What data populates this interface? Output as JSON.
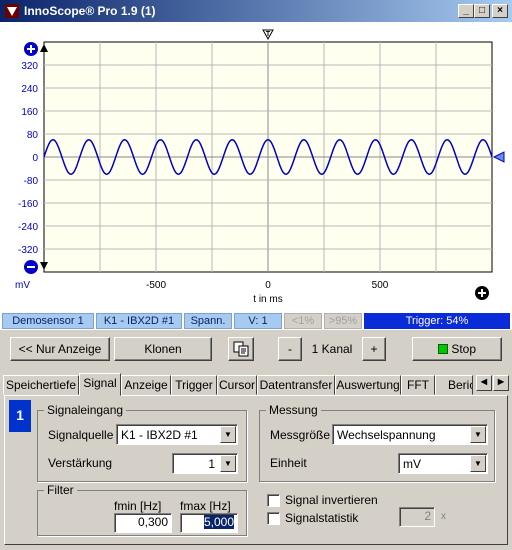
{
  "window": {
    "title": "InnoScope® Pro 1.9 (1)",
    "controls": [
      "_",
      "□",
      "×"
    ]
  },
  "plot": {
    "y_unit": "mV",
    "x_label": "t in ms",
    "trigger_marker": "T",
    "colors": {
      "trace": "#0000c8",
      "grid": "#b8b8b8",
      "background": "#fffff0"
    },
    "icons": [
      "zoom-in-icon",
      "zoom-out-icon",
      "zoom-x-icon",
      "trigger-arrow-icon"
    ]
  },
  "chart_data": {
    "type": "line",
    "xlabel": "t in ms",
    "ylabel": "mV",
    "xlim": [
      -1000,
      1000
    ],
    "ylim": [
      -400,
      400
    ],
    "x_ticks": [
      "-500",
      "0",
      "500"
    ],
    "y_ticks": [
      "320",
      "240",
      "160",
      "80",
      "0",
      "-80",
      "-160",
      "-240",
      "-320"
    ],
    "series": [
      {
        "amplitude": 60,
        "period": 160,
        "phase": 40,
        "x_range": [
          -1000,
          1000
        ]
      }
    ]
  },
  "status": {
    "sensor": "Demosensor 1",
    "channel": "K1 - IBX2D #1",
    "mode": "Spann.",
    "v": "V: 1",
    "p1": "<1%",
    "p2": ">95%",
    "trigger": "Trigger: 54%"
  },
  "toolbar": {
    "display_only": "<< Nur Anzeige",
    "clone": "Klonen",
    "minus": "-",
    "channels": "1 Kanal",
    "plus": "+",
    "stop": "Stop",
    "stop_color": "#00c800"
  },
  "tabs": [
    "Speichertiefe",
    "Signal",
    "Anzeige",
    "Trigger",
    "Cursor",
    "Datentransfer",
    "Auswertung",
    "FFT",
    "Berich"
  ],
  "active_tab": "Signal",
  "panel": {
    "channel_number": "1",
    "signal_input": {
      "title": "Signaleingang",
      "source_label": "Signalquelle",
      "source_value": "K1 - IBX2D #1",
      "gain_label": "Verstärkung",
      "gain_value": "1"
    },
    "filter": {
      "title": "Filter",
      "fmin_label": "fmin [Hz]",
      "fmin_value": "0,300",
      "fmax_label": "fmax [Hz]",
      "fmax_value": "5,000"
    },
    "measurement": {
      "title": "Messung",
      "quantity_label": "Messgröße",
      "quantity_value": "Wechselspannung",
      "unit_label": "Einheit",
      "unit_value": "mV"
    },
    "invert_label": "Signal invertieren",
    "stats_label": "Signalstatistik",
    "stats_value": "2",
    "stats_suffix": "x"
  }
}
